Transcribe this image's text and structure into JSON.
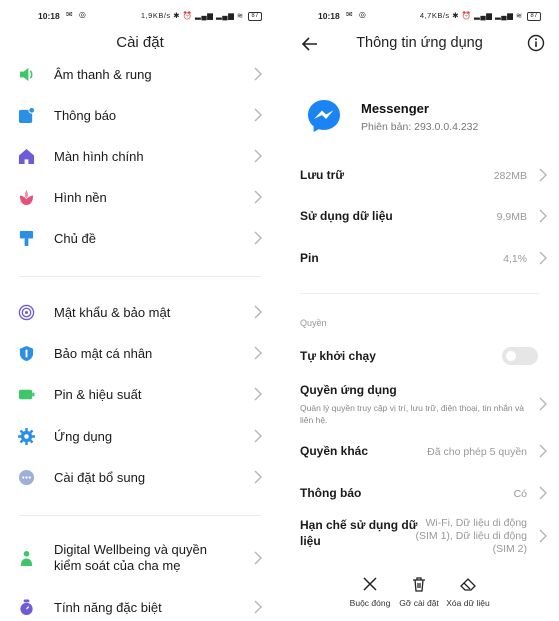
{
  "left": {
    "status": {
      "time": "10:18",
      "right_text": "1,9KB/s",
      "battery": "87"
    },
    "title": "Cài đặt",
    "items": [
      {
        "label": "Âm thanh & rung",
        "icon": "sound-icon",
        "color": "#3fc66b"
      },
      {
        "label": "Thông báo",
        "icon": "notification-icon",
        "color": "#2c8fe6"
      },
      {
        "label": "Màn hình chính",
        "icon": "home-icon",
        "color": "#6f5bd8"
      },
      {
        "label": "Hình nền",
        "icon": "wallpaper-icon",
        "color": "#e8507a"
      },
      {
        "label": "Chủ đề",
        "icon": "theme-icon",
        "color": "#2c8fe6"
      },
      {
        "label": "Mật khẩu & bảo mật",
        "icon": "fingerprint-icon",
        "color": "#6f5bd8"
      },
      {
        "label": "Bảo mật cá nhân",
        "icon": "privacy-icon",
        "color": "#2c8fe6"
      },
      {
        "label": "Pin & hiệu suất",
        "icon": "battery-icon",
        "color": "#3fc66b"
      },
      {
        "label": "Ứng dụng",
        "icon": "apps-gear-icon",
        "color": "#2c8fe6"
      },
      {
        "label": "Cài đặt bổ sung",
        "icon": "more-icon",
        "color": "#9fb0d8"
      },
      {
        "label": "Digital Wellbeing và quyền kiểm soát của cha mẹ",
        "icon": "wellbeing-icon",
        "color": "#3fc66b"
      },
      {
        "label": "Tính năng đặc biệt",
        "icon": "special-features-icon",
        "color": "#6f5bd8"
      }
    ]
  },
  "right": {
    "status": {
      "time": "10:18",
      "right_text": "4,7KB/s",
      "battery": "87"
    },
    "title": "Thông tin ứng dụng",
    "app": {
      "name": "Messenger",
      "version": "Phiên bản: 293.0.0.4.232",
      "brand_color": "#1a84f5"
    },
    "rows": {
      "storage": {
        "label": "Lưu trữ",
        "value": "282MB"
      },
      "data_usage": {
        "label": "Sử dụng dữ liệu",
        "value": "9,9MB"
      },
      "battery": {
        "label": "Pin",
        "value": "4,1%"
      },
      "section_permissions": "Quyền",
      "autostart": {
        "label": "Tự khởi chạy",
        "enabled": false
      },
      "app_permissions": {
        "label": "Quyền ứng dụng",
        "desc": "Quản lý quyền truy cập vị trí, lưu trữ, điện thoại, tin nhắn và liên hệ."
      },
      "other_permissions": {
        "label": "Quyền khác",
        "value": "Đã cho phép 5 quyền"
      },
      "notifications": {
        "label": "Thông báo",
        "value": "Có"
      },
      "restrict_data": {
        "label": "Hạn chế sử dụng dữ liệu",
        "value": "Wi-Fi, Dữ liệu di động (SIM 1), Dữ liệu di động (SIM 2)"
      }
    },
    "actions": {
      "force_stop": "Buộc đóng",
      "uninstall": "Gỡ cài đặt",
      "clear_data": "Xóa dữ liệu"
    }
  }
}
